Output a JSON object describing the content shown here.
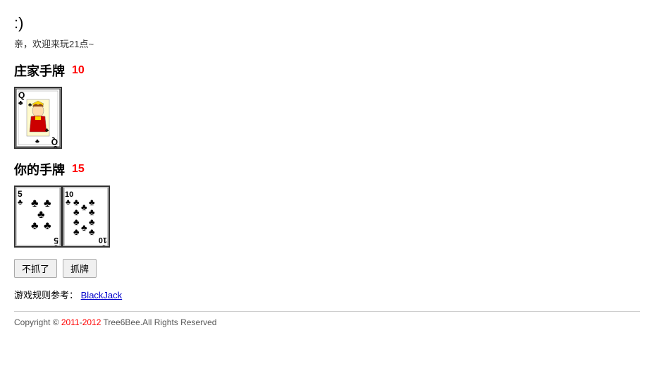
{
  "smiley": ":)",
  "welcome": "亲，欢迎来玩21点~",
  "dealer": {
    "label": "庄家手牌",
    "score": "10",
    "cards": [
      {
        "rank": "Q",
        "suit": "clubs",
        "type": "face"
      }
    ]
  },
  "player": {
    "label": "你的手牌",
    "score": "15",
    "cards": [
      {
        "rank": "5",
        "suit": "clubs",
        "type": "pip",
        "value": 5
      },
      {
        "rank": "10",
        "suit": "clubs",
        "type": "pip",
        "value": 10
      }
    ]
  },
  "buttons": {
    "stand": "不抓了",
    "hit": "抓牌"
  },
  "rules": {
    "prefix": "游戏规则参考：",
    "link_text": "BlackJack",
    "link_url": "#"
  },
  "footer": {
    "text": "Copyright © 2011-2012 Tree6Bee.All Rights Reserved",
    "year1": "2011",
    "year2": "2012"
  }
}
